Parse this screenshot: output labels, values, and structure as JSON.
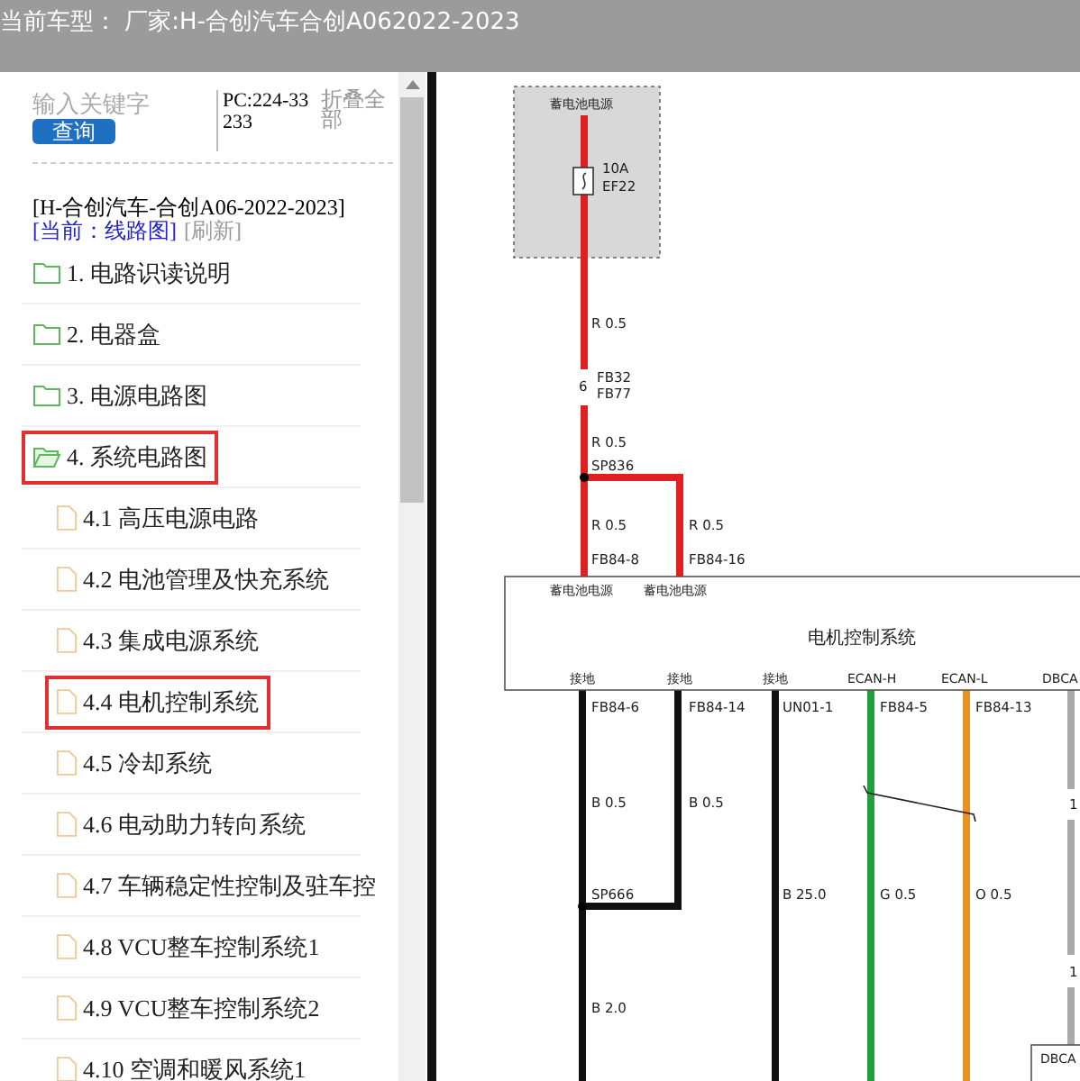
{
  "title_bar": {
    "title": "当前车型：  厂家:H-合创汽车合创A062022-2023"
  },
  "sidebar": {
    "search": {
      "placeholder": "输入关键字"
    },
    "search_button": "查询",
    "pc_code": "PC:224-33233",
    "collapse_all": "折叠全部",
    "vehicle": "[H-合创汽车-合创A06-2022-2023]",
    "current": "[当前：线路图]",
    "refresh": "[刷新]",
    "tree": [
      {
        "label": "1. 电路识读说明",
        "expanded": false,
        "selected": false
      },
      {
        "label": "2. 电器盒",
        "expanded": false,
        "selected": false
      },
      {
        "label": "3. 电源电路图",
        "expanded": false,
        "selected": false
      },
      {
        "label": "4. 系统电路图",
        "expanded": true,
        "selected": true,
        "children": [
          {
            "label": "4.1 高压电源电路",
            "selected": false
          },
          {
            "label": "4.2 电池管理及快充系统",
            "selected": false
          },
          {
            "label": "4.3 集成电源系统",
            "selected": false
          },
          {
            "label": "4.4 电机控制系统",
            "selected": true
          },
          {
            "label": "4.5 冷却系统",
            "selected": false
          },
          {
            "label": "4.6 电动助力转向系统",
            "selected": false
          },
          {
            "label": "4.7 车辆稳定性控制及驻车控",
            "selected": false
          },
          {
            "label": "4.8 VCU整车控制系统1",
            "selected": false
          },
          {
            "label": "4.9 VCU整车控制系统2",
            "selected": false
          },
          {
            "label": "4.10 空调和暖风系统1",
            "selected": false
          }
        ]
      }
    ]
  },
  "diagram": {
    "labels": [
      {
        "text": "蓄电池电源",
        "kind": "pin"
      },
      {
        "text": "10A",
        "kind": "wire"
      },
      {
        "text": "EF22",
        "kind": "wire"
      },
      {
        "text": "R 0.5",
        "kind": "wire"
      },
      {
        "text": "FB32",
        "kind": "wire"
      },
      {
        "text": "6",
        "kind": "wire"
      },
      {
        "text": "FB77",
        "kind": "wire"
      },
      {
        "text": "R 0.5",
        "kind": "wire"
      },
      {
        "text": "SP836",
        "kind": "wire"
      },
      {
        "text": "R 0.5",
        "kind": "wire"
      },
      {
        "text": "R 0.5",
        "kind": "wire"
      },
      {
        "text": "FB84-8",
        "kind": "wire"
      },
      {
        "text": "FB84-16",
        "kind": "wire"
      },
      {
        "text": "蓄电池电源",
        "kind": "pin"
      },
      {
        "text": "蓄电池电源",
        "kind": "pin"
      },
      {
        "text": "电机控制系统",
        "kind": "module"
      },
      {
        "text": "接地",
        "kind": "pin"
      },
      {
        "text": "接地",
        "kind": "pin"
      },
      {
        "text": "接地",
        "kind": "pin"
      },
      {
        "text": "ECAN-H",
        "kind": "pin"
      },
      {
        "text": "ECAN-L",
        "kind": "pin"
      },
      {
        "text": "DBCA",
        "kind": "pin"
      },
      {
        "text": "FB84-6",
        "kind": "wire"
      },
      {
        "text": "FB84-14",
        "kind": "wire"
      },
      {
        "text": "UN01-1",
        "kind": "wire"
      },
      {
        "text": "FB84-5",
        "kind": "wire"
      },
      {
        "text": "FB84-13",
        "kind": "wire"
      },
      {
        "text": "B 0.5",
        "kind": "wire"
      },
      {
        "text": "B 0.5",
        "kind": "wire"
      },
      {
        "text": "SP666",
        "kind": "wire"
      },
      {
        "text": "B 25.0",
        "kind": "wire"
      },
      {
        "text": "G 0.5",
        "kind": "wire"
      },
      {
        "text": "O 0.5",
        "kind": "wire"
      },
      {
        "text": "B 2.0",
        "kind": "wire"
      },
      {
        "text": "1",
        "kind": "wire"
      },
      {
        "text": "1",
        "kind": "wire"
      },
      {
        "text": "DBCA",
        "kind": "pin"
      }
    ]
  }
}
